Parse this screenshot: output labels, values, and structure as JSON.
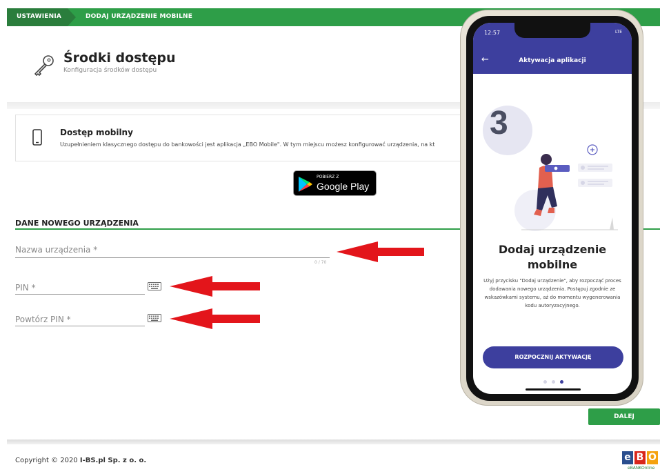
{
  "breadcrumb": {
    "first": "USTAWIENIA",
    "second": "DODAJ URZĄDZENIE MOBILNE"
  },
  "header": {
    "title": "Środki dostępu",
    "subtitle": "Konfiguracja środków dostępu"
  },
  "mobile_access": {
    "title": "Dostęp mobilny",
    "description": "Uzupełnieniem klasycznego dostępu do bankowości jest aplikacja „EBO Mobile\". W tym miejscu możesz konfigurować urządzenia, na kt"
  },
  "google_play": {
    "small": "POBIERZ Z",
    "big": "Google Play"
  },
  "form": {
    "title": "DANE NOWEGO URZĄDZENIA",
    "device_name_label": "Nazwa urządzenia *",
    "device_name_counter": "0 / 70",
    "pin_label": "PIN *",
    "pin_repeat_label": "Powtórz PIN *"
  },
  "next_button": "DALEJ",
  "footer": {
    "copyright_prefix": "Copyright © 2020 ",
    "copyright_company": "I-BS.pl Sp. z o. o."
  },
  "logo": {
    "letters": [
      "e",
      "B",
      "O"
    ],
    "sub": "eBANKOnline"
  },
  "phone": {
    "time": "12:57",
    "status": "LTE",
    "app_title": "Aktywacja aplikacji",
    "step": "3",
    "title": "Dodaj urządzenie mobilne",
    "description": "Użyj przycisku \"Dodaj urządzenie\", aby rozpocząć proces dodawania nowego urządzenia. Postępuj zgodnie ze wskazówkami systemu, aż do momentu wygenerowania kodu autoryzacyjnego.",
    "button": "ROZPOCZNIJ AKTYWACJĘ"
  },
  "colors": {
    "green": "#2e9e48",
    "dark_green": "#2a7d3c",
    "indigo": "#3d3f9e",
    "red_arrow": "#e3151b"
  }
}
